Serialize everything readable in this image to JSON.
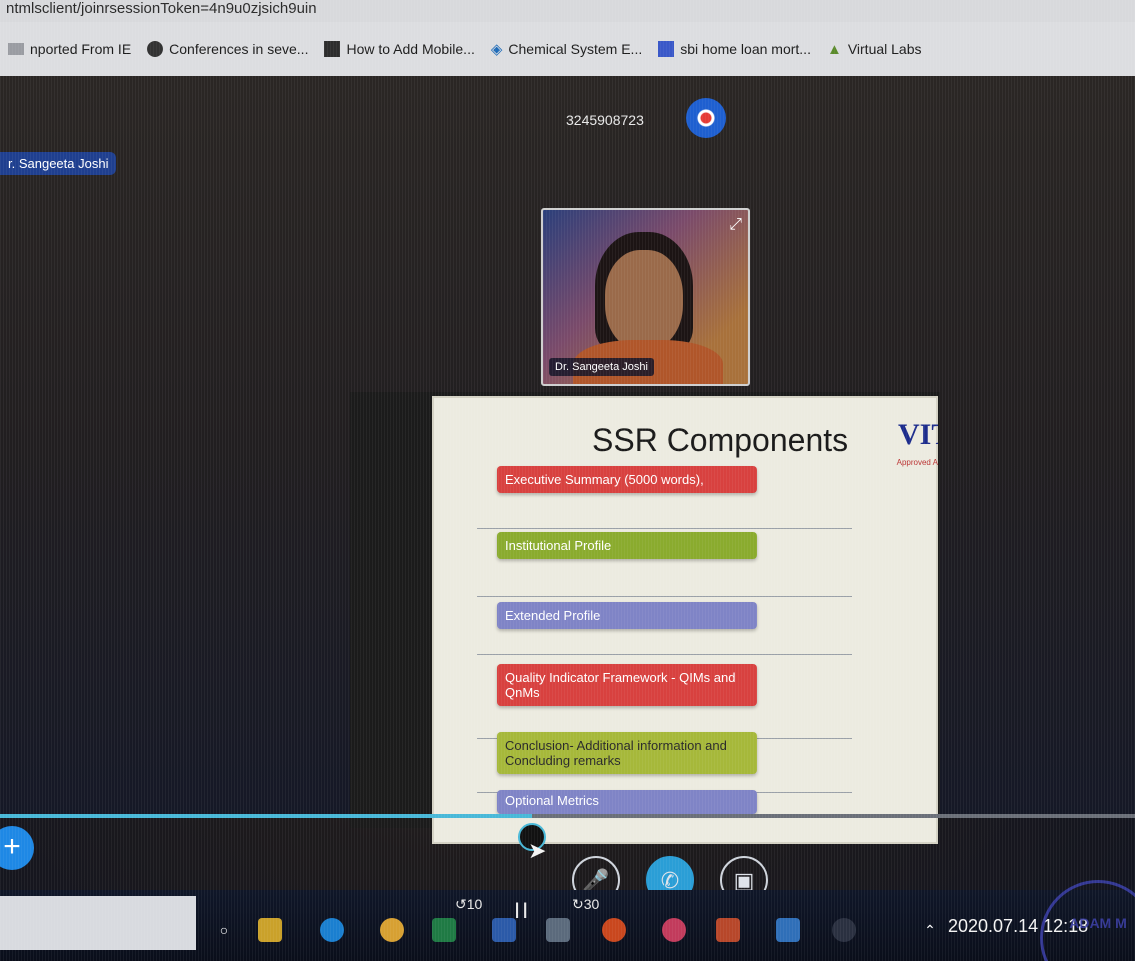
{
  "browser": {
    "url_fragment": "ntmlsclient/joinrsessionToken=4n9u0zjsich9uin",
    "bookmarks": [
      {
        "label": "nported From IE",
        "icon": "folder-icon",
        "color": "#b0b3b9"
      },
      {
        "label": "Conferences in seve...",
        "icon": "globe-icon",
        "color": "#333333"
      },
      {
        "label": "How to Add Mobile...",
        "icon": "page-icon",
        "color": "#2d2d2d"
      },
      {
        "label": "Chemical System E...",
        "icon": "molecule-icon",
        "color": "#1e6bb8"
      },
      {
        "label": "sbi home loan mort...",
        "icon": "sbi-icon",
        "color": "#3a58c8"
      },
      {
        "label": "Virtual Labs",
        "icon": "flask-icon",
        "color": "#5a8a2a"
      }
    ]
  },
  "meeting": {
    "id": "3245908723",
    "active_speaker": "r. Sangeeta Joshi",
    "participant_name": "Dr. Sangeeta Joshi"
  },
  "slide": {
    "title": "SSR Components",
    "logo": "VIT",
    "logo_sub": "Approved A",
    "components": [
      {
        "label": "Executive Summary (5000 words),",
        "color": "#d8413f"
      },
      {
        "label": "Institutional Profile",
        "color": "#8aab2e"
      },
      {
        "label": "Extended Profile",
        "color": "#7f84c6"
      },
      {
        "label": "Quality Indicator Framework - QIMs and QnMs",
        "color": "#d8413f"
      },
      {
        "label": "Conclusion- Additional information and Concluding remarks",
        "color": "#a6b83a"
      },
      {
        "label": "Optional Metrics",
        "color": "#7f84c6"
      }
    ]
  },
  "player": {
    "progress_pct": 46.9,
    "rewind_label": "10",
    "forward_label": "30",
    "pause_label": "II"
  },
  "controls": {
    "add_label": "+",
    "mute_icon": "mic-off-icon",
    "call_icon": "phone-icon",
    "video_icon": "video-off-icon"
  },
  "taskbar": {
    "timestamp": "2020.07.14 12:18",
    "stamp_text": "ADAM M"
  }
}
